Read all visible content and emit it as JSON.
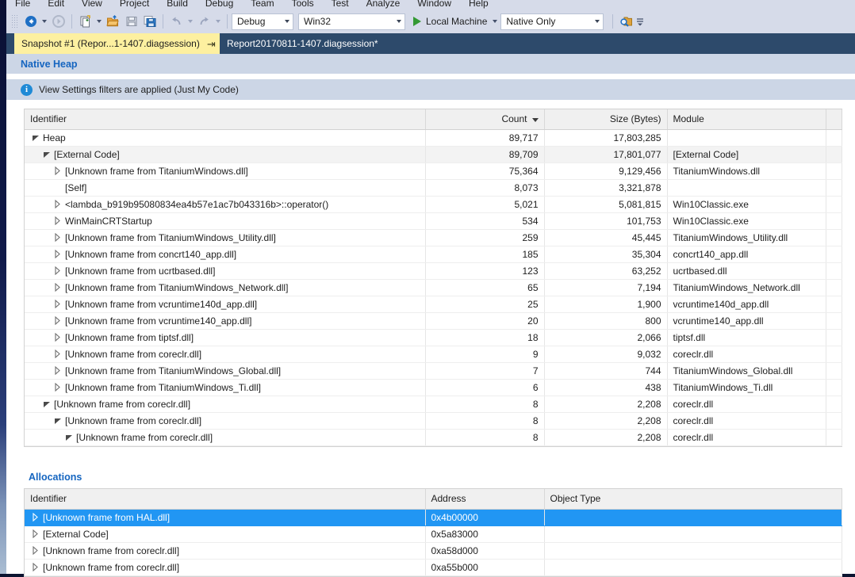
{
  "menu": {
    "items": [
      "File",
      "Edit",
      "View",
      "Project",
      "Build",
      "Debug",
      "Team",
      "Tools",
      "Test",
      "Analyze",
      "Window",
      "Help"
    ]
  },
  "toolbar": {
    "nav_back_icon": "navigate-back-icon",
    "nav_forward_icon": "navigate-forward-icon",
    "new_item_icon": "new-item-icon",
    "open_file_icon": "open-file-icon",
    "save_icon": "save-icon",
    "save_all_icon": "save-all-icon",
    "undo_icon": "undo-icon",
    "redo_icon": "redo-icon",
    "config_combo": "Debug",
    "platform_combo": "Win32",
    "start_label": "Local Machine",
    "debugger_type_combo": "Native Only",
    "find_icon": "find-in-files-icon",
    "overflow_icon": "toolbar-overflow-icon"
  },
  "tabs": [
    {
      "label": "Snapshot #1 (Repor...1-1407.diagsession)",
      "active": true,
      "pin_glyph": "⇥",
      "close_glyph": "✕"
    },
    {
      "label": "Report20170811-1407.diagsession*",
      "active": false
    }
  ],
  "native_heap": {
    "section_title": "Native Heap",
    "info_text": "View Settings filters are applied (Just My Code)",
    "info_icon": "info-icon",
    "columns": [
      {
        "key": "identifier",
        "label": "Identifier",
        "align": "left"
      },
      {
        "key": "count",
        "label": "Count",
        "align": "right",
        "sorted": true,
        "sort_dir": "desc"
      },
      {
        "key": "size",
        "label": "Size (Bytes)",
        "align": "right"
      },
      {
        "key": "module",
        "label": "Module",
        "align": "left"
      },
      {
        "key": "spare",
        "label": "",
        "align": "left"
      }
    ],
    "rows": [
      {
        "indent": 0,
        "expander": "expanded",
        "identifier": "Heap",
        "count": "89,717",
        "size": "17,803,285",
        "module": "",
        "alt": false
      },
      {
        "indent": 1,
        "expander": "expanded",
        "identifier": "[External Code]",
        "count": "89,709",
        "size": "17,801,077",
        "module": "[External Code]",
        "alt": true
      },
      {
        "indent": 2,
        "expander": "collapsed",
        "identifier": "[Unknown frame from TitaniumWindows.dll]",
        "count": "75,364",
        "size": "9,129,456",
        "module": "TitaniumWindows.dll",
        "alt": false
      },
      {
        "indent": 2,
        "expander": "none",
        "identifier": "[Self]",
        "count": "8,073",
        "size": "3,321,878",
        "module": "",
        "alt": false
      },
      {
        "indent": 2,
        "expander": "collapsed",
        "identifier": "<lambda_b919b95080834ea4b57e1ac7b043316b>::operator()",
        "count": "5,021",
        "size": "5,081,815",
        "module": "Win10Classic.exe",
        "alt": false
      },
      {
        "indent": 2,
        "expander": "collapsed",
        "identifier": "WinMainCRTStartup",
        "count": "534",
        "size": "101,753",
        "module": "Win10Classic.exe",
        "alt": false
      },
      {
        "indent": 2,
        "expander": "collapsed",
        "identifier": "[Unknown frame from TitaniumWindows_Utility.dll]",
        "count": "259",
        "size": "45,445",
        "module": "TitaniumWindows_Utility.dll",
        "alt": false
      },
      {
        "indent": 2,
        "expander": "collapsed",
        "identifier": "[Unknown frame from concrt140_app.dll]",
        "count": "185",
        "size": "35,304",
        "module": "concrt140_app.dll",
        "alt": false
      },
      {
        "indent": 2,
        "expander": "collapsed",
        "identifier": "[Unknown frame from ucrtbased.dll]",
        "count": "123",
        "size": "63,252",
        "module": "ucrtbased.dll",
        "alt": false
      },
      {
        "indent": 2,
        "expander": "collapsed",
        "identifier": "[Unknown frame from TitaniumWindows_Network.dll]",
        "count": "65",
        "size": "7,194",
        "module": "TitaniumWindows_Network.dll",
        "alt": false
      },
      {
        "indent": 2,
        "expander": "collapsed",
        "identifier": "[Unknown frame from vcruntime140d_app.dll]",
        "count": "25",
        "size": "1,900",
        "module": "vcruntime140d_app.dll",
        "alt": false
      },
      {
        "indent": 2,
        "expander": "collapsed",
        "identifier": "[Unknown frame from vcruntime140_app.dll]",
        "count": "20",
        "size": "800",
        "module": "vcruntime140_app.dll",
        "alt": false
      },
      {
        "indent": 2,
        "expander": "collapsed",
        "identifier": "[Unknown frame from tiptsf.dll]",
        "count": "18",
        "size": "2,066",
        "module": "tiptsf.dll",
        "alt": false
      },
      {
        "indent": 2,
        "expander": "collapsed",
        "identifier": "[Unknown frame from coreclr.dll]",
        "count": "9",
        "size": "9,032",
        "module": "coreclr.dll",
        "alt": false
      },
      {
        "indent": 2,
        "expander": "collapsed",
        "identifier": "[Unknown frame from TitaniumWindows_Global.dll]",
        "count": "7",
        "size": "744",
        "module": "TitaniumWindows_Global.dll",
        "alt": false
      },
      {
        "indent": 2,
        "expander": "collapsed",
        "identifier": "[Unknown frame from TitaniumWindows_Ti.dll]",
        "count": "6",
        "size": "438",
        "module": "TitaniumWindows_Ti.dll",
        "alt": false
      },
      {
        "indent": 1,
        "expander": "expanded",
        "identifier": "[Unknown frame from coreclr.dll]",
        "count": "8",
        "size": "2,208",
        "module": "coreclr.dll",
        "alt": false
      },
      {
        "indent": 2,
        "expander": "expanded",
        "identifier": "[Unknown frame from coreclr.dll]",
        "count": "8",
        "size": "2,208",
        "module": "coreclr.dll",
        "alt": false
      },
      {
        "indent": 3,
        "expander": "expanded",
        "identifier": "[Unknown frame from coreclr.dll]",
        "count": "8",
        "size": "2,208",
        "module": "coreclr.dll",
        "alt": false
      }
    ]
  },
  "allocations": {
    "section_title": "Allocations",
    "columns": [
      {
        "key": "identifier",
        "label": "Identifier",
        "align": "left"
      },
      {
        "key": "address",
        "label": "Address",
        "align": "left"
      },
      {
        "key": "object_type",
        "label": "Object Type",
        "align": "left"
      }
    ],
    "rows": [
      {
        "expander": "collapsed",
        "identifier": "[Unknown frame from HAL.dll]",
        "address": "0x4b00000",
        "object_type": "",
        "selected": true
      },
      {
        "expander": "collapsed",
        "identifier": "[External Code]",
        "address": "0x5a83000",
        "object_type": "",
        "selected": false
      },
      {
        "expander": "collapsed",
        "identifier": "[Unknown frame from coreclr.dll]",
        "address": "0xa58d000",
        "object_type": "",
        "selected": false
      },
      {
        "expander": "collapsed",
        "identifier": "[Unknown frame from coreclr.dll]",
        "address": "0xa55b000",
        "object_type": "",
        "selected": false
      }
    ]
  },
  "colors": {
    "accent_blue": "#1565c0",
    "selection_blue": "#2196f3",
    "tab_active_yellow": "#fdf0a0",
    "chrome_blue": "#2d4a6b",
    "band_blue": "#ccd6e6"
  }
}
